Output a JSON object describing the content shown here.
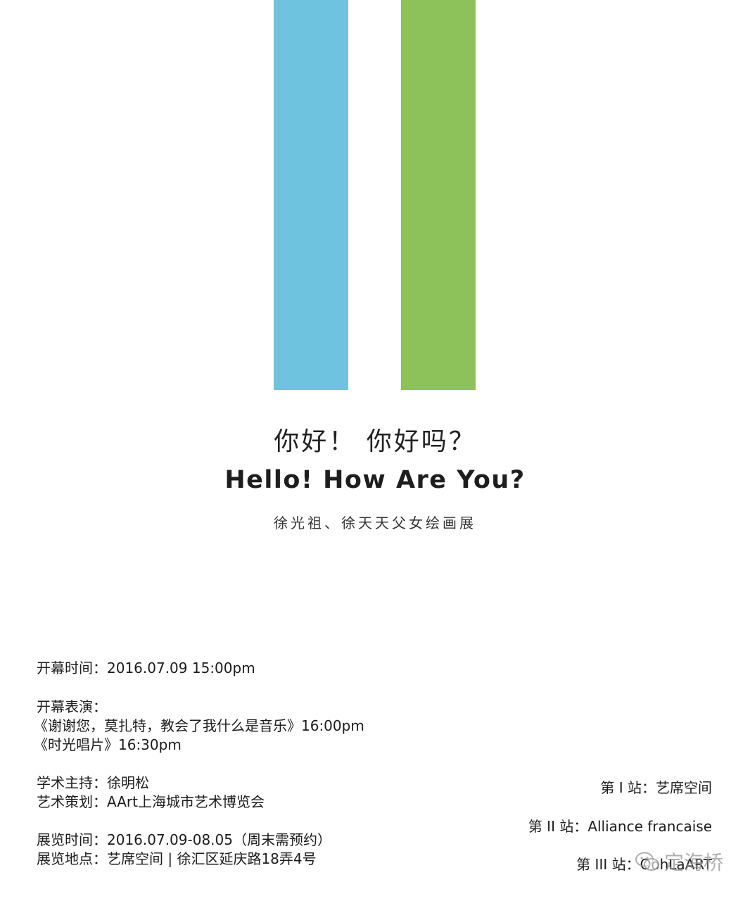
{
  "colors": {
    "blue_bar": "#6ec4df",
    "green_bar": "#8dc15a"
  },
  "title_cn": "你好！ 你好吗？",
  "title_en": "Hello! How Are You?",
  "subtitle": "徐光祖、徐天天父女绘画展",
  "info": {
    "opening_time": "开幕时间：2016.07.09  15:00pm",
    "performance_heading": "开幕表演：",
    "performance_1": "《谢谢您，莫扎特，教会了我什么是音乐》16:00pm",
    "performance_2": "《时光唱片》16:30pm",
    "academic_host": "学术主持：徐明松",
    "art_planning": "艺术策划：AArt上海城市艺术博览会",
    "exhibition_time": "展览时间：2016.07.09-08.05（周末需预约）",
    "exhibition_venue": "展览地点：艺席空间 | 徐汇区延庆路18弄4号"
  },
  "stations": {
    "station_1": "第 I 站：艺席空间",
    "station_2": "第 II 站：Alliance francaise",
    "station_3": "第 III 站：OohLaART"
  },
  "watermark": {
    "text": "定海桥",
    "icon": "wechat-icon"
  }
}
